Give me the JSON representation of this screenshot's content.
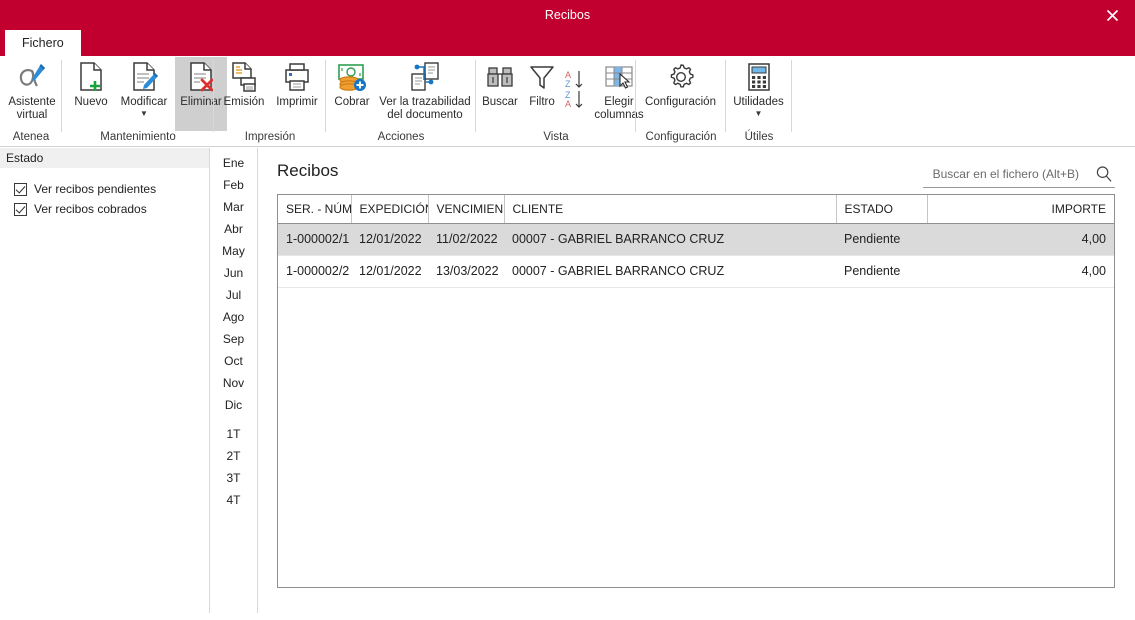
{
  "window": {
    "title": "Recibos",
    "close_icon": "close-icon",
    "accent_color": "#c2002f"
  },
  "ribbon": {
    "tab": {
      "label": "Fichero"
    },
    "groups": [
      {
        "name": "atenea",
        "label": "Atenea",
        "buttons": [
          {
            "name": "asistente-virtual",
            "label": "Asistente\nvirtual",
            "icon": "alpha-pen-icon",
            "selected": false,
            "caret": false
          }
        ]
      },
      {
        "name": "mantenimiento",
        "label": "Mantenimiento",
        "buttons": [
          {
            "name": "nuevo",
            "label": "Nuevo",
            "icon": "document-plus-icon",
            "selected": false,
            "caret": false
          },
          {
            "name": "modificar",
            "label": "Modificar",
            "icon": "document-pencil-icon",
            "selected": false,
            "caret": true
          },
          {
            "name": "eliminar",
            "label": "Eliminar",
            "icon": "document-delete-icon",
            "selected": true,
            "caret": false
          }
        ]
      },
      {
        "name": "impresion",
        "label": "Impresión",
        "buttons": [
          {
            "name": "emision",
            "label": "Emisión",
            "icon": "document-print-icon",
            "selected": false,
            "caret": false
          },
          {
            "name": "imprimir",
            "label": "Imprimir",
            "icon": "printer-icon",
            "selected": false,
            "caret": false
          }
        ]
      },
      {
        "name": "acciones",
        "label": "Acciones",
        "buttons": [
          {
            "name": "cobrar",
            "label": "Cobrar",
            "icon": "money-coins-plus-icon",
            "selected": false,
            "caret": false
          },
          {
            "name": "ver-la-trazabilidad-del-documento",
            "label": "Ver la trazabilidad\ndel documento",
            "icon": "traceability-icon",
            "selected": false,
            "caret": false
          }
        ]
      },
      {
        "name": "vista",
        "label": "Vista",
        "buttons": [
          {
            "name": "buscar",
            "label": "Buscar",
            "icon": "binoculars-icon",
            "selected": false,
            "caret": false
          },
          {
            "name": "filtro",
            "label": "Filtro",
            "icon": "funnel-icon",
            "selected": false,
            "caret": false
          },
          {
            "name": "ordenar",
            "label": "",
            "icon": "sort-az-za-icon",
            "selected": false,
            "caret": false
          },
          {
            "name": "elegir-columnas",
            "label": "Elegir\ncolumnas",
            "icon": "choose-columns-icon",
            "selected": false,
            "caret": false
          }
        ]
      },
      {
        "name": "configuracion",
        "label": "Configuración",
        "buttons": [
          {
            "name": "configuracion",
            "label": "Configuración",
            "icon": "gear-icon",
            "selected": false,
            "caret": false
          }
        ]
      },
      {
        "name": "utiles",
        "label": "Útiles",
        "buttons": [
          {
            "name": "utilidades",
            "label": "Utilidades",
            "icon": "calculator-icon",
            "selected": false,
            "caret": true
          }
        ]
      }
    ]
  },
  "left_panel": {
    "header": "Estado",
    "filters": [
      {
        "label": "Ver recibos pendientes",
        "checked": true
      },
      {
        "label": "Ver recibos cobrados",
        "checked": true
      }
    ]
  },
  "month_column": {
    "months": [
      "Ene",
      "Feb",
      "Mar",
      "Abr",
      "May",
      "Jun",
      "Jul",
      "Ago",
      "Sep",
      "Oct",
      "Nov",
      "Dic"
    ],
    "quarters": [
      "1T",
      "2T",
      "3T",
      "4T"
    ]
  },
  "main": {
    "title": "Recibos",
    "search": {
      "placeholder": "Buscar en el fichero (Alt+B)",
      "value": "",
      "icon": "search-icon"
    },
    "table": {
      "columns": [
        {
          "key": "ser_num",
          "label": "SER. - NÚM.",
          "align": "left"
        },
        {
          "key": "expedicion",
          "label": "EXPEDICIÓN",
          "align": "left"
        },
        {
          "key": "vencimiento",
          "label": "VENCIMIEN...",
          "align": "left"
        },
        {
          "key": "cliente",
          "label": "CLIENTE",
          "align": "left"
        },
        {
          "key": "estado",
          "label": "ESTADO",
          "align": "left"
        },
        {
          "key": "importe",
          "label": "IMPORTE",
          "align": "right"
        }
      ],
      "rows": [
        {
          "selected": true,
          "ser_num": "1-000002/1",
          "expedicion": "12/01/2022",
          "vencimiento": "11/02/2022",
          "cliente": "00007 - GABRIEL BARRANCO CRUZ",
          "estado": "Pendiente",
          "importe": "4,00"
        },
        {
          "selected": false,
          "ser_num": "1-000002/2",
          "expedicion": "12/01/2022",
          "vencimiento": "13/03/2022",
          "cliente": "00007 - GABRIEL BARRANCO CRUZ",
          "estado": "Pendiente",
          "importe": "4,00"
        }
      ]
    }
  }
}
